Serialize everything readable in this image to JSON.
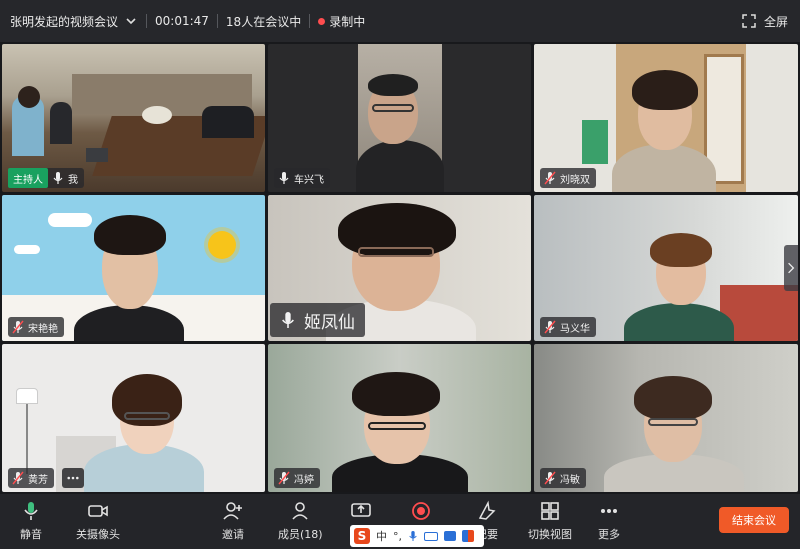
{
  "topbar": {
    "meeting_title": "张明发起的视频会议",
    "duration": "00:01:47",
    "participants_text": "18人在会议中",
    "recording_text": "录制中",
    "fullscreen_label": "全屏"
  },
  "tiles": [
    {
      "name": "我",
      "host_badge": "主持人"
    },
    {
      "name": "车兴飞"
    },
    {
      "name": "刘晓双"
    },
    {
      "name": "宋艳艳"
    },
    {
      "name": "姬凤仙"
    },
    {
      "name": "马义华"
    },
    {
      "name": "黄芳"
    },
    {
      "name": "冯婷"
    },
    {
      "name": "冯敏"
    }
  ],
  "toolbar": {
    "mute_label": "静音",
    "camera_label": "关摄像头",
    "invite_label": "邀请",
    "members_label": "成员(18)",
    "share_label": "",
    "record_label": "",
    "minutes_label": "纪要",
    "switch_view_label": "切换视图",
    "more_label": "更多",
    "end_label": "结束会议"
  },
  "ime": {
    "logo": "S",
    "mode": "中"
  },
  "colors": {
    "accent_green": "#19a15f",
    "recording_red": "#ff4d4f",
    "end_button": "#f05a28"
  }
}
